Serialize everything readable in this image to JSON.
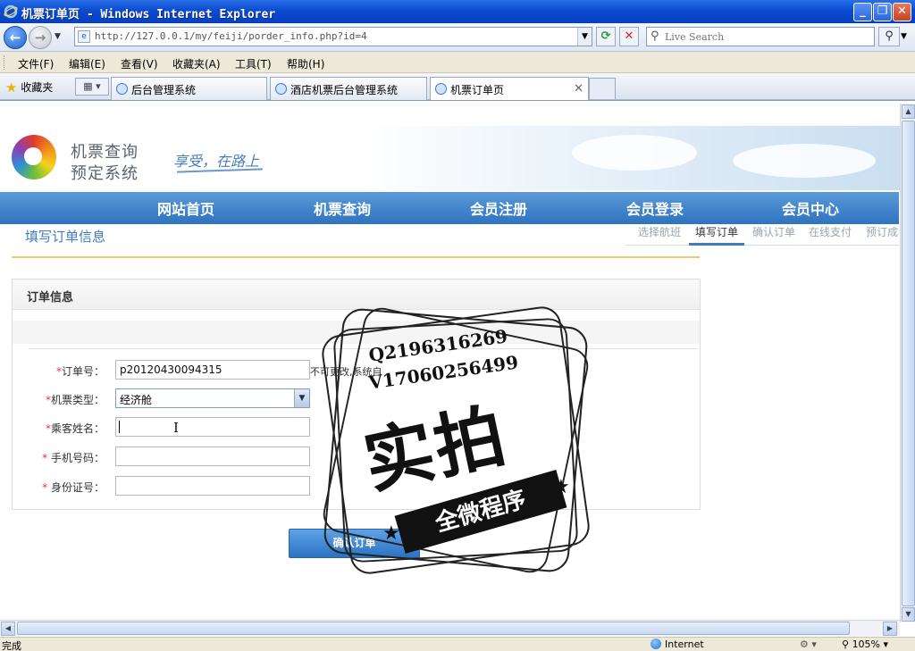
{
  "window": {
    "title": "机票订单页 - Windows Internet Explorer",
    "minimize": "_",
    "restore": "❐",
    "close": "✕"
  },
  "addressbar": {
    "url": "http://127.0.0.1/my/feiji/porder_info.php?id=4",
    "search_placeholder": "Live Search"
  },
  "menu": [
    "文件(F)",
    "编辑(E)",
    "查看(V)",
    "收藏夹(A)",
    "工具(T)",
    "帮助(H)"
  ],
  "favorites_label": "收藏夹",
  "tabs": [
    {
      "label": "后台管理系统",
      "active": false
    },
    {
      "label": "酒店机票后台管理系统",
      "active": false
    },
    {
      "label": "机票订单页",
      "active": true
    }
  ],
  "site": {
    "logo_line1": "机票查询",
    "logo_line2": "预定系统",
    "slogan": "享受，在路上",
    "nav": [
      "网站首页",
      "机票查询",
      "会员注册",
      "会员登录",
      "会员中心"
    ],
    "page_heading": "填写订单信息",
    "steps": [
      "选择航班",
      "填写订单",
      "确认订单",
      "在线支付",
      "预订成"
    ],
    "current_step": "填写订单"
  },
  "order_form": {
    "section_title": "订单信息",
    "fields": {
      "order_no": {
        "label": "订单号：",
        "value": "p20120430094315",
        "hint": "不可更改,系统自"
      },
      "ticket_type": {
        "label": "机票类型：",
        "value": "经济舱"
      },
      "passenger_name": {
        "label": "乘客姓名：",
        "value": ""
      },
      "phone": {
        "label": "手机号码：",
        "value": ""
      },
      "id_card": {
        "label": "身份证号：",
        "value": ""
      }
    },
    "required_mark": "*",
    "submit_label": "确认订单"
  },
  "watermark": {
    "line1": "Q2196316269",
    "line2": "V17060256499",
    "big": "实拍",
    "ribbon": "全微程序"
  },
  "statusbar": {
    "text": "完成",
    "zone": "Internet",
    "zoom": "105%"
  }
}
